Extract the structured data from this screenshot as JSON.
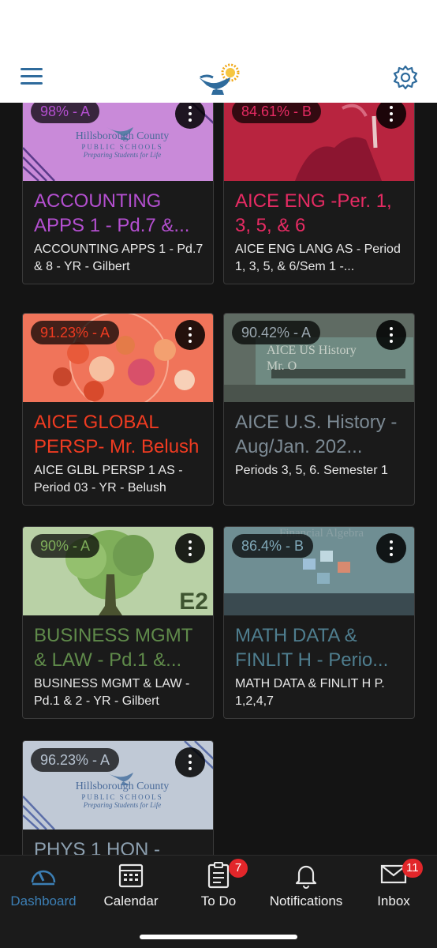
{
  "nav": {
    "menu_icon": "hamburger-icon",
    "logo_icon": "lamp-of-knowledge-logo",
    "settings_icon": "gear-icon"
  },
  "courses": [
    {
      "grade": "98% - A",
      "title": "ACCOUNTING APPS 1 - Pd.7 &...",
      "subtitle": "ACCOUNTING APPS 1 - Pd.7 & 8 - YR - Gilbert",
      "color": "#b44fd0",
      "banner": "#c98ad9",
      "image": "hillsborough-county-logo",
      "image_text": [
        "Hillsborough County",
        "PUBLIC SCHOOLS",
        "Preparing Students for Life"
      ]
    },
    {
      "grade": "84.61% - B",
      "title": "AICE ENG -Per. 1, 3, 5, & 6",
      "subtitle": "AICE ENG LANG AS - Period 1, 3, 5, & 6/Sem 1 -...",
      "color": "#e62b63",
      "banner": "#b8243f",
      "image": "graduate-photo"
    },
    {
      "grade": "91.23% - A",
      "title": "AICE GLOBAL PERSP- Mr. Belush",
      "subtitle": "AICE GLBL PERSP 1 AS - Period 03 - YR - Belush",
      "color": "#ef3b21",
      "banner": "#f0745a",
      "image": "world-flags-globe"
    },
    {
      "grade": "90.42% - A",
      "title": "AICE U.S. History - Aug/Jan. 202...",
      "subtitle": "Periods 3, 5, 6.   Semester 1",
      "color": "#7c8a94",
      "banner": "#5f6b63",
      "image": "nighthawks-painting",
      "image_text": [
        "AICE US History",
        "Mr. O"
      ]
    },
    {
      "grade": "90% - A",
      "title": "BUSINESS MGMT & LAW - Pd.1 &...",
      "subtitle": "BUSINESS MGMT & LAW - Pd.1 & 2 - YR - Gilbert",
      "color": "#5f8a4a",
      "banner": "#b9d1a6",
      "image": "tree-illustration",
      "image_text": [
        "E2"
      ]
    },
    {
      "grade": "86.4% - B",
      "title": "MATH DATA & FINLIT H - Perio...",
      "subtitle": "MATH DATA & FINLIT H P. 1,2,4,7",
      "color": "#4f7e8f",
      "banner": "#6f8e93",
      "image": "financial-algebra-cover",
      "image_text": [
        "Financial Algebra"
      ]
    },
    {
      "grade": "96.23% - A",
      "title": "PHYS 1 HON -",
      "subtitle": "",
      "color": "#8da0b0",
      "banner": "#c0c9d6",
      "image": "hillsborough-county-logo",
      "image_text": [
        "Hillsborough County",
        "PUBLIC SCHOOLS",
        "Preparing Students for Life"
      ]
    }
  ],
  "tabs": [
    {
      "label": "Dashboard",
      "icon": "dashboard-icon",
      "active": true
    },
    {
      "label": "Calendar",
      "icon": "calendar-icon"
    },
    {
      "label": "To Do",
      "icon": "todo-icon",
      "badge": "7"
    },
    {
      "label": "Notifications",
      "icon": "bell-icon"
    },
    {
      "label": "Inbox",
      "icon": "inbox-icon",
      "badge": "11"
    }
  ],
  "colors": {
    "accent": "#3c7fb5",
    "badge": "#e2262a"
  }
}
